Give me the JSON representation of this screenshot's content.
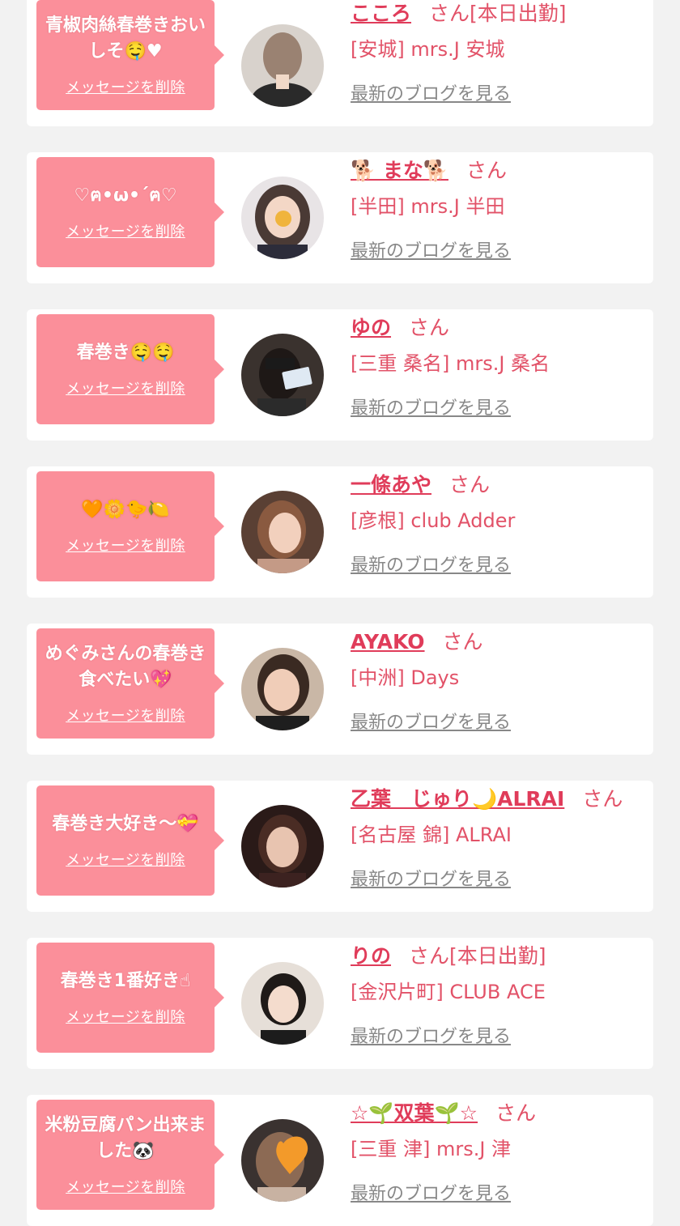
{
  "common": {
    "delete_label": "メッセージを削除",
    "san_label": "さん",
    "blog_label": "最新のブログを見る"
  },
  "colors": {
    "background": "#f2f2f2",
    "bubble": "#fb8f9a",
    "accent": "#e03c5a",
    "link_gray": "#888888"
  },
  "messages": [
    {
      "msg": "青椒肉絲春巻きおいしそ🤤♥",
      "name": "こころ",
      "status": "[本日出勤]",
      "shop": "[安城] mrs.J 安城"
    },
    {
      "msg": "♡ฅ•ω•´ฅ♡",
      "name": "🐕 まな🐕",
      "status": "",
      "shop": "[半田] mrs.J 半田"
    },
    {
      "msg": "春巻き🤤🤤",
      "name": "ゆの",
      "status": "",
      "shop": "[三重 桑名] mrs.J 桑名"
    },
    {
      "msg": "🧡🌼🐤🍋",
      "name": "一條あや",
      "status": "",
      "shop": "[彦根] club Adder"
    },
    {
      "msg": "めぐみさんの春巻き食べたい💖",
      "name": "AYAKO",
      "status": "",
      "shop": "[中洲] Days"
    },
    {
      "msg": "春巻き大好き〜💝",
      "name": "乙葉　じゅり🌙ALRAI",
      "status": "",
      "shop": "[名古屋 錦] ALRAI"
    },
    {
      "msg": "春巻き1番好き☝",
      "name": "りの",
      "status": "[本日出勤]",
      "shop": "[金沢片町] CLUB ACE"
    },
    {
      "msg": "米粉豆腐パン出来ました🐼",
      "name": "☆🌱双葉🌱☆",
      "status": "",
      "shop": "[三重 津] mrs.J 津"
    }
  ]
}
